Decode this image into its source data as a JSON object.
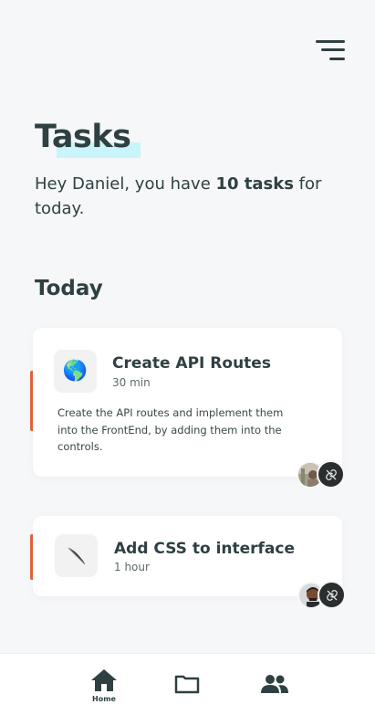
{
  "header": {
    "menu_icon": "menu-lines-icon"
  },
  "page": {
    "title": "Tasks",
    "greeting_prefix": "Hey Daniel, you have ",
    "greeting_count": "10 tasks",
    "greeting_suffix": " for today."
  },
  "sections": {
    "today_title": "Today"
  },
  "tasks": [
    {
      "emoji": "🌎",
      "title": "Create API Routes",
      "duration": "30 min",
      "description": "Create the API routes and implement them into the FrontEnd, by adding them into the controls.",
      "accent_color": "#e0653c",
      "icons": [
        "avatar",
        "link-icon"
      ]
    },
    {
      "emoji": "🪶",
      "title": "Add CSS to interface",
      "duration": "1 hour",
      "accent_color": "#e0653c",
      "icons": [
        "avatar",
        "link-icon"
      ]
    }
  ],
  "bottom_nav": {
    "items": [
      {
        "icon": "home-icon",
        "label": "Home",
        "active": true
      },
      {
        "icon": "folder-icon",
        "label": "",
        "active": false
      },
      {
        "icon": "people-icon",
        "label": "",
        "active": false
      }
    ]
  },
  "colors": {
    "background": "#f6f7f8",
    "text_dark": "#2f4043",
    "highlight": "#c8f4fa",
    "accent": "#e0653c"
  }
}
